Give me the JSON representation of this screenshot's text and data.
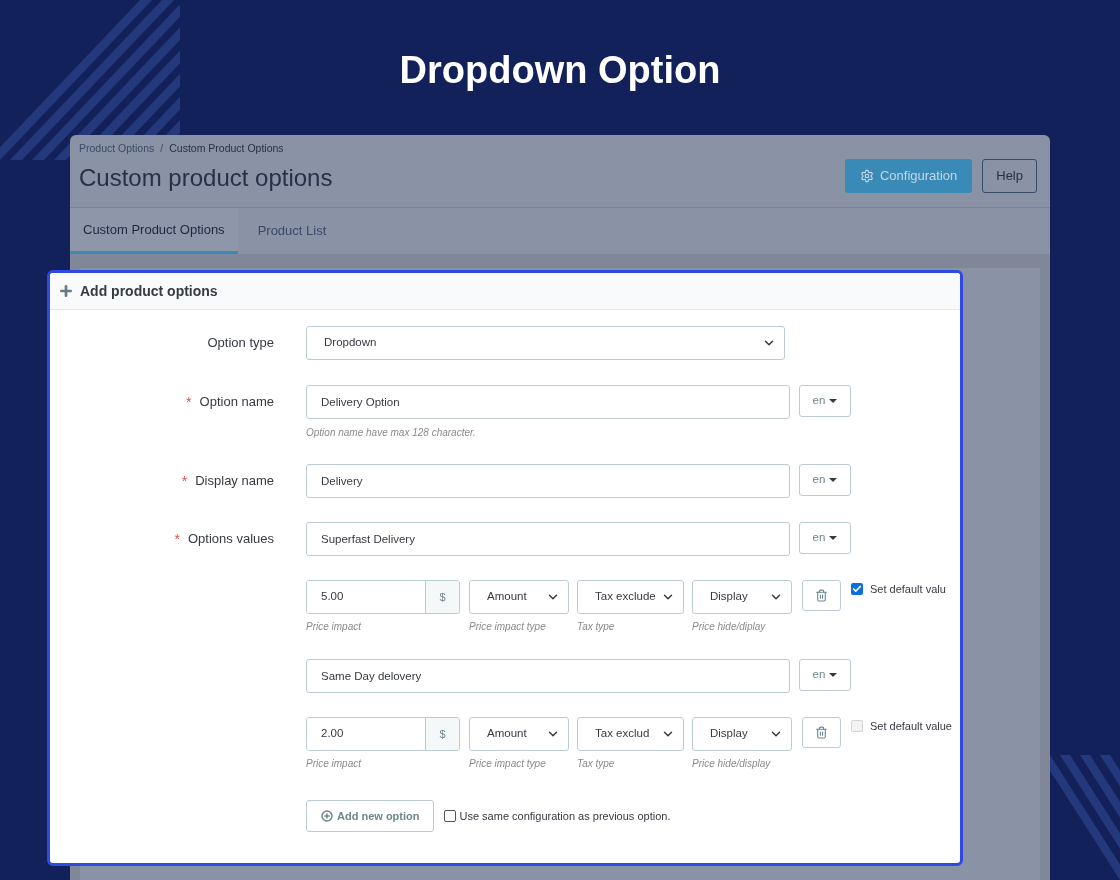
{
  "title": "Dropdown Option",
  "page": {
    "breadcrumb": [
      "Product Options",
      "Custom Product Options"
    ],
    "breadcrumb_separator": "/",
    "heading": "Custom product options",
    "buttons": [
      {
        "kind": "primary",
        "label": "Configuration"
      },
      {
        "kind": "default",
        "label": "Help"
      }
    ],
    "tabs": [
      {
        "label": "Custom Product Options",
        "selected": true
      },
      {
        "label": "Product List",
        "selected": false
      }
    ]
  },
  "panel": {
    "title": "Add product options",
    "option_type": {
      "label": "Option type",
      "value": "Dropdown"
    },
    "option_name": {
      "label": "Option name",
      "required_mark": "*",
      "value": "Delivery Option",
      "language": "en",
      "help": "Option name have max 128 character."
    },
    "display_name": {
      "label": "Display name",
      "required_mark": "*",
      "value": "Delivery",
      "language": "en"
    },
    "options_values": {
      "label": "Options values",
      "required_mark": "*",
      "values": [
        {
          "name": "Superfast Delivery",
          "language": "en",
          "price": "5.00",
          "currency": "$",
          "impact_type": "Amount",
          "tax_type": "Tax exclude",
          "display": "Display",
          "default_label": "Set default valu",
          "is_default": true,
          "hints": [
            "Price impact",
            "Price impact type",
            "Tax type",
            "Price hide/diplay"
          ]
        },
        {
          "name": "Same Day delovery",
          "language": "en",
          "price": "2.00",
          "currency": "$",
          "impact_type": "Amount",
          "tax_type": "Tax exclud",
          "display": "Display",
          "default_label": "Set default value",
          "is_default": false,
          "hints": [
            "Price impact",
            "Price impact type",
            "Tax type",
            "Price hide/display"
          ]
        }
      ]
    },
    "add_button": "Add new option",
    "same_config": {
      "label": "Use same configuration as previous option.",
      "checked": false
    }
  }
}
